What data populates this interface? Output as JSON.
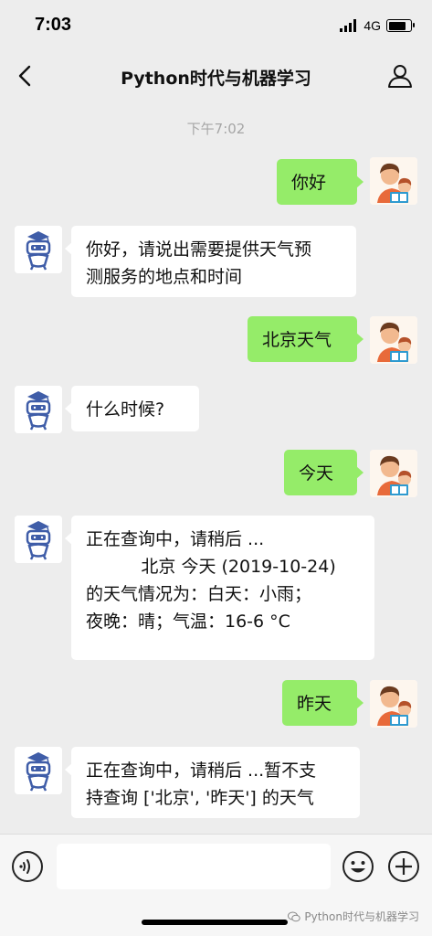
{
  "status_bar": {
    "time": "7:03",
    "network": "4G",
    "battery_level": 0.8
  },
  "nav": {
    "title": "Python时代与机器学习"
  },
  "chat": {
    "timestamp": "下午7:02",
    "messages": [
      {
        "from": "user",
        "text": "你好"
      },
      {
        "from": "bot",
        "text": "你好，请说出需要提供天气预\n测服务的地点和时间"
      },
      {
        "from": "user",
        "text": "北京天气"
      },
      {
        "from": "bot",
        "text": "什么时候?"
      },
      {
        "from": "user",
        "text": "今天"
      },
      {
        "from": "bot",
        "text": "正在查询中，请稍后 ...\n          北京 今天 (2019-10-24)\n的天气情况为：白天：小雨；\n夜晚：晴；气温：16-6 °C\n"
      },
      {
        "from": "user",
        "text": "昨天"
      },
      {
        "from": "bot",
        "text": "正在查询中，请稍后 ...暂不支\n持查询 ['北京', '昨天'] 的天气"
      }
    ]
  },
  "input": {
    "placeholder": ""
  },
  "watermark": {
    "text": "Python时代与机器学习"
  },
  "colors": {
    "outgoing_bubble": "#95ec69",
    "incoming_bubble": "#ffffff",
    "background": "#ededed"
  }
}
